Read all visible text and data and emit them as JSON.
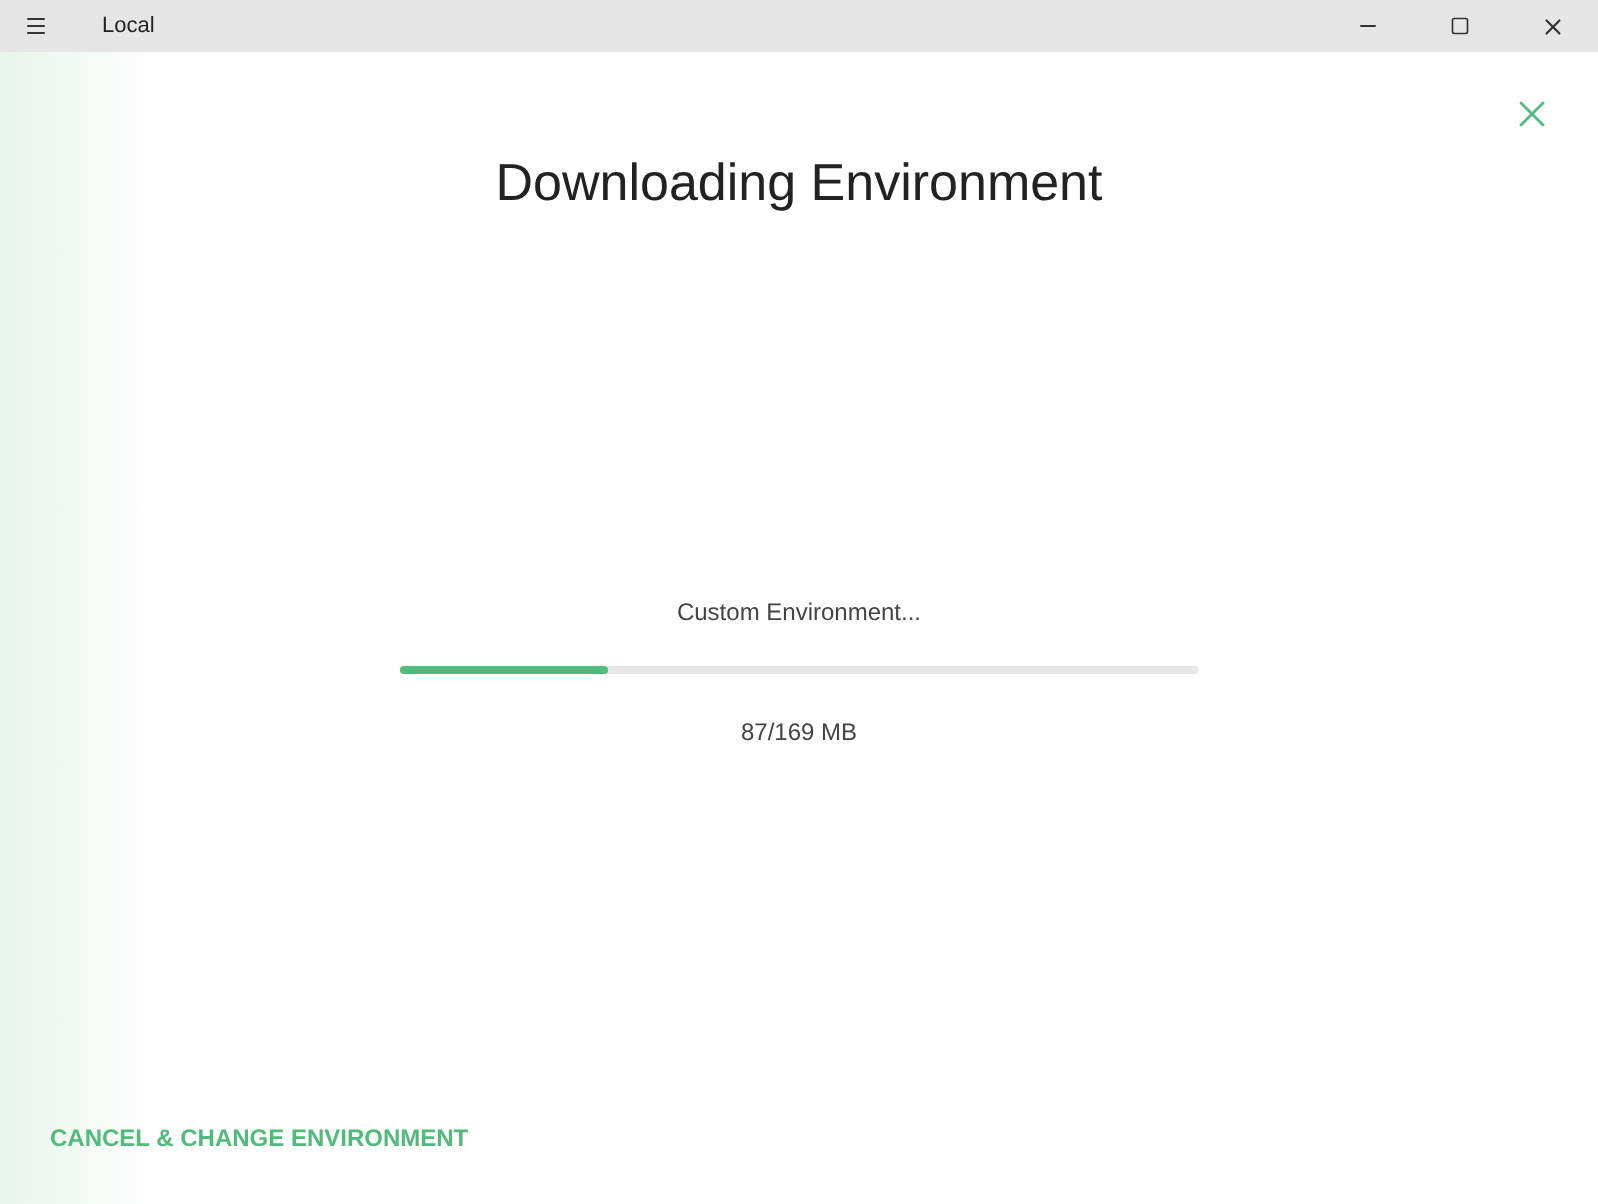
{
  "window": {
    "title": "Local"
  },
  "heading": "Downloading Environment",
  "download": {
    "label": "Custom Environment...",
    "level": 0.26,
    "reading": "87/169 MB"
  },
  "cancel_link": "CANCEL & CHANGE ENVIRONMENT"
}
